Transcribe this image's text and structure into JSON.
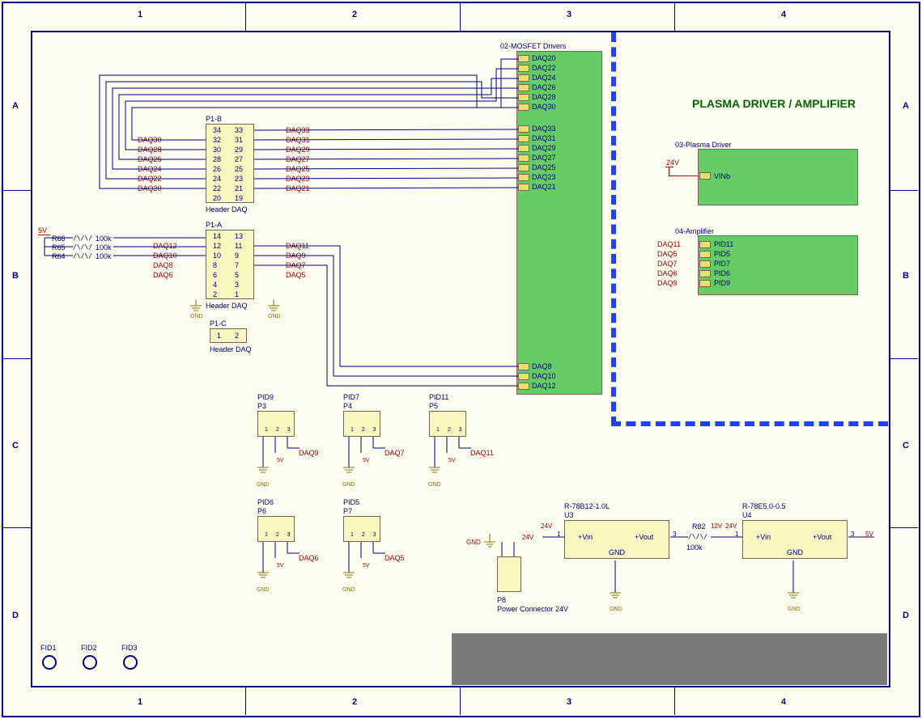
{
  "title": "PLASMA DRIVER / AMPLIFIER",
  "grid": {
    "cols": [
      "1",
      "2",
      "3",
      "4"
    ],
    "rows": [
      "A",
      "B",
      "C",
      "D"
    ]
  },
  "mosfet": {
    "title": "02-MOSFET Drivers",
    "left_ports": [
      "DAQ20",
      "DAQ22",
      "DAQ24",
      "DAQ26",
      "DAQ28",
      "DAQ30",
      "DAQ33",
      "DAQ31",
      "DAQ29",
      "DAQ27",
      "DAQ25",
      "DAQ23",
      "DAQ21",
      "DAQ8",
      "DAQ10",
      "DAQ12"
    ]
  },
  "plasma": {
    "title": "03-Plasma Driver",
    "port": "VINb",
    "net": "24V"
  },
  "amp": {
    "title": "04-Amplifier",
    "ports": [
      "PID11",
      "PID5",
      "PID7",
      "PID6",
      "PID9"
    ],
    "nets": [
      "DAQ11",
      "DAQ5",
      "DAQ7",
      "DAQ6",
      "DAQ9"
    ]
  },
  "p1b": {
    "ref": "P1-B",
    "name": "Header DAQ",
    "left_pins": [
      "34",
      "32",
      "30",
      "28",
      "26",
      "24",
      "22",
      "20"
    ],
    "right_pins": [
      "33",
      "31",
      "29",
      "27",
      "25",
      "23",
      "21",
      "19"
    ],
    "left_nets": [
      "",
      "DAQ30",
      "DAQ28",
      "DAQ26",
      "DAQ24",
      "DAQ22",
      "DAQ20",
      ""
    ],
    "right_nets": [
      "DAQ33",
      "DAQ31",
      "DAQ29",
      "DAQ27",
      "DAQ25",
      "DAQ23",
      "DAQ21",
      ""
    ]
  },
  "p1a": {
    "ref": "P1-A",
    "name": "Header DAQ",
    "left_pins": [
      "14",
      "12",
      "10",
      "8",
      "6",
      "4",
      "2"
    ],
    "right_pins": [
      "13",
      "11",
      "9",
      "7",
      "5",
      "3",
      "1"
    ],
    "left_nets": [
      "",
      "DAQ12",
      "DAQ10",
      "DAQ8",
      "DAQ6",
      "",
      ""
    ],
    "right_nets": [
      "",
      "DAQ11",
      "DAQ9",
      "DAQ7",
      "DAQ5",
      "",
      ""
    ]
  },
  "p1c": {
    "ref": "P1-C",
    "name": "Header DAQ",
    "pins": [
      "1",
      "2"
    ]
  },
  "pid_blocks": [
    {
      "ref": "P3",
      "title": "PID9",
      "daq": "DAQ9"
    },
    {
      "ref": "P4",
      "title": "PID7",
      "daq": "DAQ7"
    },
    {
      "ref": "P5",
      "title": "PID11",
      "daq": "DAQ11"
    },
    {
      "ref": "P6",
      "title": "PID6",
      "daq": "DAQ6"
    },
    {
      "ref": "P7",
      "title": "PID5",
      "daq": "DAQ5"
    }
  ],
  "resistors": {
    "r66": "R66",
    "r65": "R65",
    "r64": "R64",
    "r82": "R82",
    "val100k": "100k"
  },
  "power": {
    "p8_ref": "P8",
    "p8_name": "Power Connector 24V",
    "u3_ref": "U3",
    "u3_name": "R-78B12-1.0L",
    "u4_ref": "U4",
    "u4_name": "R-78E5.0-0.5",
    "vin": "+Vin",
    "vout": "+Vout",
    "gnd": "GND",
    "v24": "24V",
    "v12": "12V",
    "v5": "5V",
    "pin1": "1",
    "pin3": "3"
  },
  "misc": {
    "gnd": "GND",
    "five": "5V",
    "pins123": "1  2  3"
  },
  "fids": [
    "FID1",
    "FID2",
    "FID3"
  ]
}
